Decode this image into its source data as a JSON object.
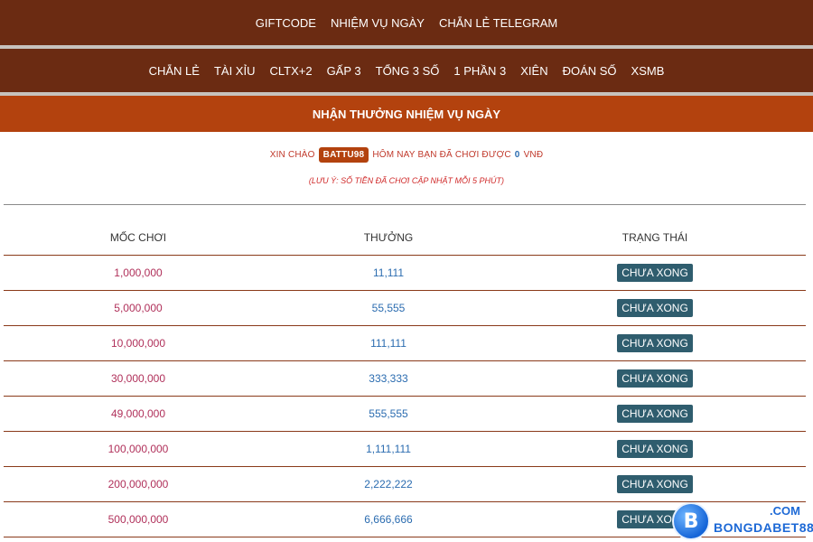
{
  "nav_top": [
    "GIFTCODE",
    "NHIỆM VỤ NGÀY",
    "CHẴN LẺ TELEGRAM"
  ],
  "nav_games": [
    "CHẴN LẺ",
    "TÀI XỈU",
    "CLTX+2",
    "GẤP 3",
    "TỔNG 3 SỐ",
    "1 PHẦN 3",
    "XIÊN",
    "ĐOÁN SỐ",
    "XSMB"
  ],
  "section_title": "NHẬN THƯỞNG NHIỆM VỤ NGÀY",
  "greeting": {
    "prefix": "XIN CHÀO",
    "username": "BATTU98",
    "middle": "HÔM NAY BẠN ĐÃ CHƠI ĐƯỢC",
    "amount": "0",
    "currency": "VNĐ"
  },
  "note": "(LƯU Ý: SỐ TIỀN ĐÃ CHƠI CẬP NHẬT MỖI 5 PHÚT)",
  "table": {
    "headers": [
      "MỐC CHƠI",
      "THƯỞNG",
      "TRẠNG THÁI"
    ],
    "rows": [
      {
        "moc": "1,000,000",
        "thuong": "11,111",
        "status": "CHƯA XONG"
      },
      {
        "moc": "5,000,000",
        "thuong": "55,555",
        "status": "CHƯA XONG"
      },
      {
        "moc": "10,000,000",
        "thuong": "111,111",
        "status": "CHƯA XONG"
      },
      {
        "moc": "30,000,000",
        "thuong": "333,333",
        "status": "CHƯA XONG"
      },
      {
        "moc": "49,000,000",
        "thuong": "555,555",
        "status": "CHƯA XONG"
      },
      {
        "moc": "100,000,000",
        "thuong": "1,111,111",
        "status": "CHƯA XONG"
      },
      {
        "moc": "200,000,000",
        "thuong": "2,222,222",
        "status": "CHƯA XONG"
      },
      {
        "moc": "500,000,000",
        "thuong": "6,666,666",
        "status": "CHƯA XONG"
      }
    ]
  },
  "watermark": {
    "letter": "B",
    "name": "BONGDABET88",
    "suffix": ".COM"
  },
  "colors": {
    "nav_bg": "#6b2b12",
    "title_bg": "#b3420e",
    "status_btn": "#2f5d6e",
    "amount_blue": "#2b6cb0",
    "moc_red": "#b0305a"
  }
}
